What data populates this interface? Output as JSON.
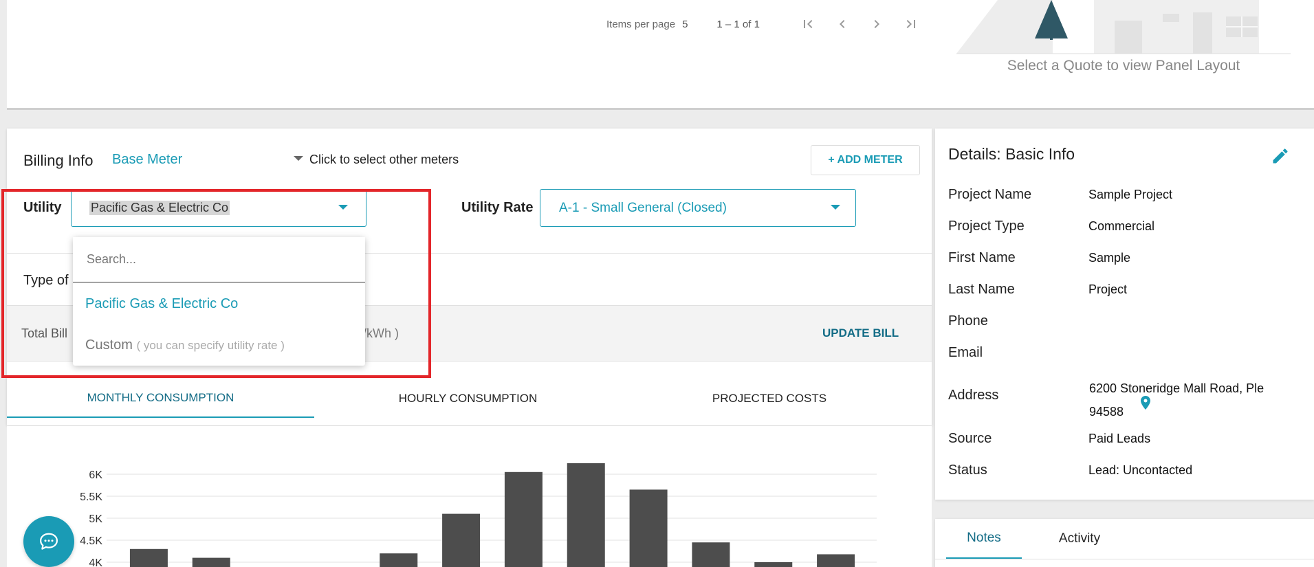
{
  "pager": {
    "items_per_page_label": "Items per page",
    "items_per_page_value": "5",
    "range": "1 – 1 of 1"
  },
  "panel_preview": {
    "caption": "Select a Quote to view Panel Layout"
  },
  "billing": {
    "title": "Billing Info",
    "meter": "Base Meter",
    "meter_hint": "Click to select other meters",
    "add_meter_label": "+ ADD METER",
    "utility_label": "Utility",
    "utility_value": "Pacific Gas & Electric Co",
    "rate_label": "Utility Rate",
    "rate_value": "A-1 - Small General (Closed)",
    "type_label": "Type of",
    "total_bill_label": "Total Bill",
    "unit_label": "$/kWh )",
    "update_bill_label": "UPDATE BILL"
  },
  "dropdown": {
    "search_placeholder": "Search...",
    "options": [
      {
        "label": "Pacific Gas & Electric Co"
      },
      {
        "label": "Custom",
        "hint": "( you can specify utility rate )"
      }
    ]
  },
  "tabs": [
    {
      "label": "MONTHLY CONSUMPTION",
      "active": true
    },
    {
      "label": "HOURLY CONSUMPTION",
      "active": false
    },
    {
      "label": "PROJECTED COSTS",
      "active": false
    }
  ],
  "chart_data": {
    "type": "bar",
    "y_tick_labels": [
      "4K",
      "4.5K",
      "5K",
      "5.5K",
      "6K"
    ],
    "y_ticks": [
      4000,
      4500,
      5000,
      5500,
      6000
    ],
    "ylim_visible": [
      4000,
      6300
    ],
    "values": [
      4300,
      4100,
      null,
      null,
      4200,
      5100,
      6050,
      6250,
      5650,
      4450,
      4000,
      4180
    ],
    "grid": true,
    "bar_color": "#4d4d4d"
  },
  "details": {
    "title": "Details: Basic Info",
    "rows": [
      {
        "label": "Project Name",
        "value": "Sample Project"
      },
      {
        "label": "Project Type",
        "value": "Commercial"
      },
      {
        "label": "First Name",
        "value": "Sample"
      },
      {
        "label": "Last Name",
        "value": "Project"
      },
      {
        "label": "Phone",
        "value": ""
      },
      {
        "label": "Email",
        "value": ""
      },
      {
        "label": "Address",
        "value": ""
      },
      {
        "label": "Source",
        "value": "Paid Leads"
      },
      {
        "label": "Status",
        "value": "Lead: Uncontacted"
      }
    ],
    "address_line1": "6200 Stoneridge Mall Road, Ple",
    "address_line2": "94588"
  },
  "notes_tabs": [
    {
      "label": "Notes",
      "active": true
    },
    {
      "label": "Activity",
      "active": false
    }
  ],
  "colors": {
    "accent": "#1a9bb5",
    "accent_dark": "#136c86",
    "highlight": "#e3262a"
  }
}
